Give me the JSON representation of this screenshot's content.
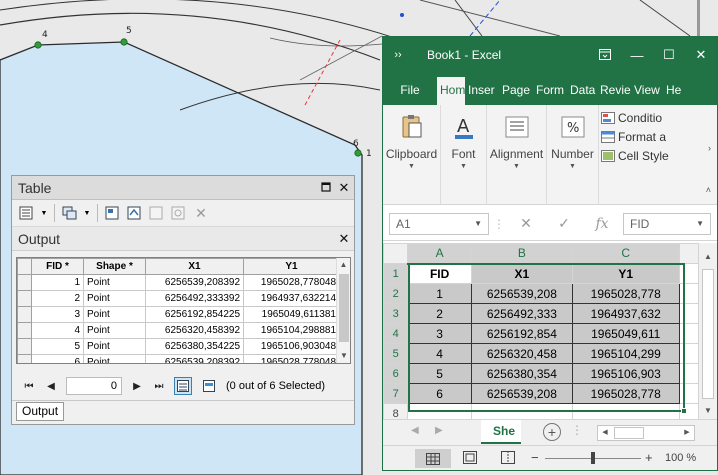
{
  "map": {
    "point_labels": [
      "4",
      "5",
      "6",
      "1"
    ]
  },
  "table_window": {
    "title": "Table",
    "subtitle": "Output",
    "columns": [
      "FID *",
      "Shape *",
      "X1",
      "Y1"
    ],
    "rows": [
      {
        "fid": "1",
        "shape": "Point",
        "x1": "6256539,208392",
        "y1": "1965028,778048"
      },
      {
        "fid": "2",
        "shape": "Point",
        "x1": "6256492,333392",
        "y1": "1964937,632214"
      },
      {
        "fid": "3",
        "shape": "Point",
        "x1": "6256192,854225",
        "y1": "1965049,611381"
      },
      {
        "fid": "4",
        "shape": "Point",
        "x1": "6256320,458392",
        "y1": "1965104,298881"
      },
      {
        "fid": "5",
        "shape": "Point",
        "x1": "6256380,354225",
        "y1": "1965106,903048"
      },
      {
        "fid": "6",
        "shape": "Point",
        "x1": "6256539,208392",
        "y1": "1965028,778048"
      }
    ],
    "nav": {
      "record": "0",
      "selection_status": "(0 out of 6 Selected)"
    },
    "tab_label": "Output"
  },
  "excel": {
    "title": "Book1  -  Excel",
    "tabs": [
      "File",
      "Hom",
      "Inser",
      "Page",
      "Form",
      "Data",
      "Revie",
      "View",
      "He"
    ],
    "ribbon": {
      "clipboard": "Clipboard",
      "font": "Font",
      "alignment": "Alignment",
      "number": "Number",
      "styles": [
        "Conditio",
        "Format a",
        "Cell Style"
      ]
    },
    "name_box": "A1",
    "formula_value": "FID",
    "column_headers": [
      "A",
      "B",
      "C"
    ],
    "row_headers": [
      "1",
      "2",
      "3",
      "4",
      "5",
      "6",
      "7",
      "8"
    ],
    "header_row": [
      "FID",
      "X1",
      "Y1"
    ],
    "rows": [
      [
        "1",
        "6256539,208",
        "1965028,778"
      ],
      [
        "2",
        "6256492,333",
        "1964937,632"
      ],
      [
        "3",
        "6256192,854",
        "1965049,611"
      ],
      [
        "4",
        "6256320,458",
        "1965104,299"
      ],
      [
        "5",
        "6256380,354",
        "1965106,903"
      ],
      [
        "6",
        "6256539,208",
        "1965028,778"
      ]
    ],
    "sheet_tab": "She",
    "zoom": "100 %"
  }
}
